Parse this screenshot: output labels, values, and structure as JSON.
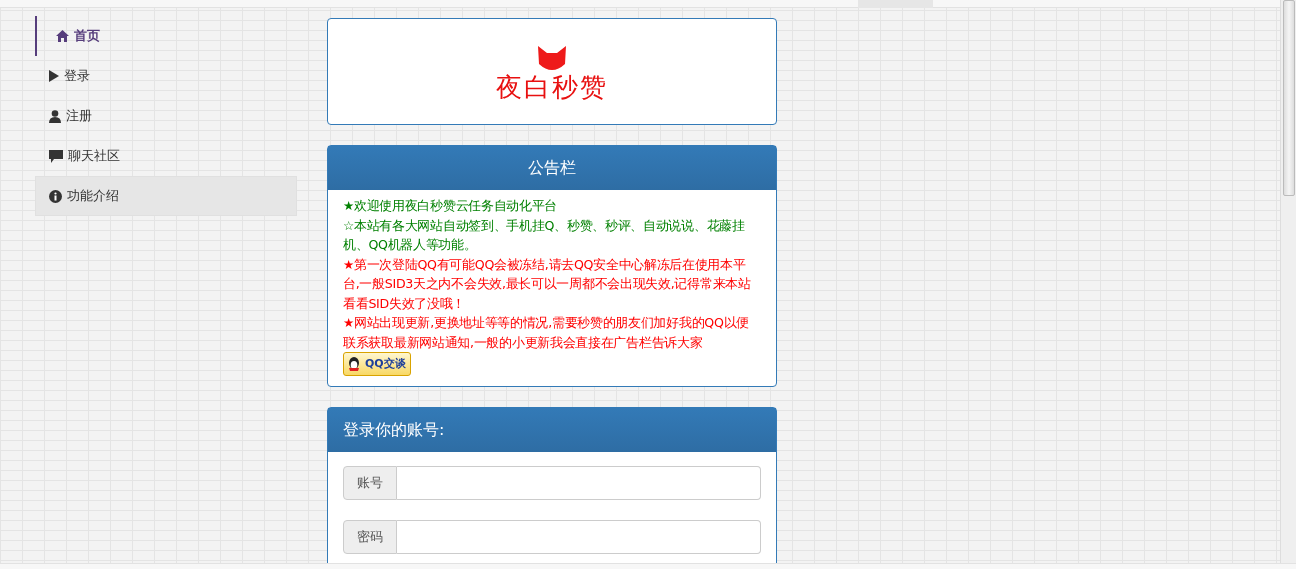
{
  "sidebar": {
    "items": [
      {
        "label": "首页",
        "selected": true,
        "hovered": false
      },
      {
        "label": "登录",
        "selected": false,
        "hovered": false
      },
      {
        "label": "注册",
        "selected": false,
        "hovered": false
      },
      {
        "label": "聊天社区",
        "selected": false,
        "hovered": false
      },
      {
        "label": "功能介绍",
        "selected": false,
        "hovered": true
      }
    ]
  },
  "logo": {
    "text": "夜白秒赞"
  },
  "notice": {
    "title": "公告栏",
    "lines": [
      {
        "text": "★欢迎使用夜白秒赞云任务自动化平台",
        "color": "#008000"
      },
      {
        "text": "☆本站有各大网站自动签到、手机挂Q、秒赞、秒评、自动说说、花藤挂机、QQ机器人等功能。",
        "color": "#008000"
      },
      {
        "text": "★第一次登陆QQ有可能QQ会被冻结,请去QQ安全中心解冻后在使用本平台,一般SID3天之内不会失效,最长可以一周都不会出现失效,记得常来本站看看SID失效了没哦！",
        "color": "#ff0000"
      },
      {
        "text": "★网站出现更新,更换地址等等的情况,需要秒赞的朋友们加好我的QQ以便联系获取最新网站通知,一般的小更新我会直接在广告栏告诉大家",
        "color": "#ff0000"
      }
    ],
    "qq_button": "QQ交谈"
  },
  "login": {
    "title": "登录你的账号:",
    "fields": [
      {
        "label": "账号"
      },
      {
        "label": "密码"
      }
    ]
  }
}
